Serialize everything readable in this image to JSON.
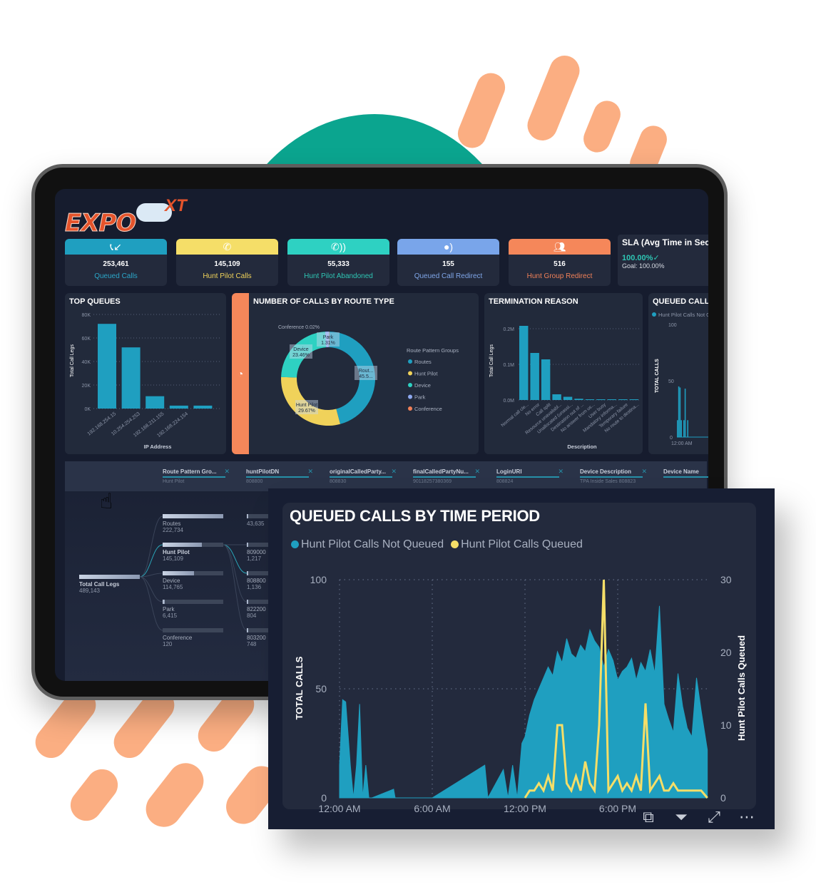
{
  "brand": {
    "logo_text": "EXPO",
    "logo_sup": "XT"
  },
  "kpis": [
    {
      "value": "253,461",
      "label": "Queued Calls",
      "icon": "phone-incoming-icon",
      "color": "#1f9fc0",
      "label_color": "#2ba7c9"
    },
    {
      "value": "145,109",
      "label": "Hunt Pilot Calls",
      "icon": "phone-icon",
      "color": "#f5de68",
      "label_color": "#f0d25a"
    },
    {
      "value": "55,333",
      "label": "Hunt Pilot Abandoned",
      "icon": "phone-ringing-icon",
      "color": "#2ed1c2",
      "label_color": "#2ec6b4"
    },
    {
      "value": "155",
      "label": "Queued Call Redirect",
      "icon": "user-voice-icon",
      "color": "#79a5ea",
      "label_color": "#7fa6e8"
    },
    {
      "value": "516",
      "label": "Hunt Group Redirect",
      "icon": "users-icon",
      "color": "#f5875a",
      "label_color": "#f08058"
    }
  ],
  "sla": {
    "title": "SLA (Avg Time in Secs",
    "value": "100.00%",
    "check": "✓",
    "goal": "Goal: 100.00%"
  },
  "top_queues": {
    "title": "TOP QUEUES",
    "chart_data": {
      "type": "bar",
      "title": "TOP QUEUES",
      "xlabel": "IP Address",
      "ylabel": "Total Call Legs",
      "ylim": [
        0,
        80000
      ],
      "yticks": [
        "0K",
        "20K",
        "40K",
        "60K",
        "80K"
      ],
      "categories": [
        "192.168.254.15",
        "10.254.254.253",
        "192.168.211.155",
        "192.168.224.154"
      ],
      "values": [
        72000,
        52000,
        10500,
        2500,
        2500
      ],
      "extra_category_count_note": ""
    }
  },
  "route_type": {
    "title": "NUMBER OF CALLS BY ROUTE TYPE",
    "strip_icon": "pie-chart-icon",
    "chart_data": {
      "type": "pie",
      "title": "NUMBER OF CALLS BY ROUTE TYPE",
      "legend_title": "Route Pattern Groups",
      "legend_position": "right",
      "slices": [
        {
          "name": "Routes",
          "value": 45.54,
          "label": "Rout... 45.5...",
          "color": "#1f9fc0"
        },
        {
          "name": "Hunt Pilot",
          "value": 29.67,
          "label": "Hunt Pilot 29.67%",
          "color": "#f0d25a"
        },
        {
          "name": "Device",
          "value": 23.46,
          "label": "Device 23.46%",
          "color": "#2ed1c2"
        },
        {
          "name": "Park",
          "value": 1.31,
          "label": "Park 1.31%",
          "color": "#8ea9f0"
        },
        {
          "name": "Conference",
          "value": 0.02,
          "label": "Conference 0.02%",
          "color": "#f08058"
        }
      ]
    }
  },
  "termination": {
    "title": "TERMINATION REASON",
    "chart_data": {
      "type": "bar",
      "title": "TERMINATION REASON",
      "xlabel": "Description",
      "ylabel": "Total Call Legs",
      "ylim": [
        0,
        200000
      ],
      "yticks": [
        "0.0M",
        "0.1M",
        "0.2M"
      ],
      "categories": [
        "Normal call cle...",
        "No error",
        "Call split",
        "Resource unavailabl...",
        "Unallocated (unassi...",
        "Destination out of ...",
        "No answer from us...",
        "User busy",
        "Mandatory informa...",
        "Temporary failure",
        "No route to destina..."
      ],
      "values": [
        208000,
        132000,
        114000,
        16000,
        9000,
        3500,
        1000,
        800,
        600,
        500,
        400
      ]
    }
  },
  "queued_small": {
    "title": "QUEUED CALLS BY TIME PERIOD",
    "legend": "Hunt Pilot Calls Not Queued",
    "ylabel": "TOTAL CALLS",
    "yticks": [
      "0",
      "50",
      "100"
    ],
    "xtick": "12:00 AM"
  },
  "filters": [
    {
      "header": "Route Pattern Gro...",
      "value": "Hunt Pilot"
    },
    {
      "header": "huntPilotDN",
      "value": "808800"
    },
    {
      "header": "originalCalledParty...",
      "value": "808830"
    },
    {
      "header": "finalCalledPartyNu...",
      "value": "90118257380369"
    },
    {
      "header": "LoginURI",
      "value": "808824"
    },
    {
      "header": "Device Description",
      "value": "TPA Inside Sales 808823"
    },
    {
      "header": "Device Name",
      "value": ""
    }
  ],
  "decomposition": {
    "root": {
      "name": "Total Call Legs",
      "value": "489,143"
    },
    "level1": [
      {
        "name": "Routes",
        "value": "222,734",
        "fill": 1.0
      },
      {
        "name": "Hunt Pilot",
        "value": "145,109",
        "fill": 0.65
      },
      {
        "name": "Device",
        "value": "114,765",
        "fill": 0.52
      },
      {
        "name": "Park",
        "value": "6,415",
        "fill": 0.03
      },
      {
        "name": "Conference",
        "value": "120",
        "fill": 0.0
      }
    ],
    "level2": [
      {
        "name": "",
        "value": "43,635"
      },
      {
        "name": "809000",
        "value": "1,217"
      },
      {
        "name": "808800",
        "value": "1,136"
      },
      {
        "name": "822200",
        "value": "804"
      },
      {
        "name": "803200",
        "value": "748"
      }
    ]
  },
  "main_chart": {
    "title": "QUEUED CALLS BY TIME PERIOD",
    "legend": [
      {
        "name": "Hunt Pilot Calls Not Queued",
        "color": "#1f9fc0"
      },
      {
        "name": "Hunt Pilot Calls Queued",
        "color": "#f5de68"
      }
    ],
    "toolbar": [
      {
        "name": "copy-icon",
        "glyph": "⧉"
      },
      {
        "name": "filter-icon",
        "glyph": "⏷"
      },
      {
        "name": "expand-icon",
        "glyph": "⤢"
      },
      {
        "name": "more-icon",
        "glyph": "⋯"
      }
    ]
  },
  "chart_data": {
    "type": "area",
    "title": "QUEUED CALLS BY TIME PERIOD",
    "xlabel": "",
    "ylabel": "TOTAL CALLS",
    "y2label": "Hunt Pilot Calls Queued",
    "ylim": [
      0,
      100
    ],
    "y2lim": [
      0,
      30
    ],
    "yticks": [
      0,
      50,
      100
    ],
    "y2ticks": [
      0,
      10,
      20,
      30
    ],
    "xticks": [
      "12:00 AM",
      "6:00 AM",
      "12:00 PM",
      "6:00 PM"
    ],
    "x_hours": [
      0,
      0.2,
      0.4,
      0.7,
      0.9,
      1.1,
      1.3,
      1.5,
      1.7,
      1.9,
      2.1,
      3.5,
      3.6,
      6,
      9.4,
      9.6,
      10.6,
      10.9,
      11.2,
      11.5,
      11.8,
      12.0,
      12.3,
      12.6,
      12.9,
      13.2,
      13.5,
      13.8,
      14.1,
      14.4,
      14.7,
      15.0,
      15.3,
      15.6,
      15.9,
      16.2,
      16.5,
      16.8,
      17.1,
      17.4,
      17.7,
      18.0,
      18.3,
      18.6,
      18.9,
      19.2,
      19.5,
      19.8,
      20.1,
      20.4,
      20.7,
      21.0,
      21.3,
      21.6,
      21.9,
      22.2,
      22.5,
      22.8,
      23.1,
      23.4,
      23.8
    ],
    "series": [
      {
        "name": "Hunt Pilot Calls Not Queued",
        "axis": "left",
        "values": [
          15,
          45,
          44,
          15,
          0,
          15,
          43,
          0,
          15,
          0,
          0,
          4,
          0,
          0,
          15,
          0,
          13,
          0,
          15,
          0,
          25,
          28,
          38,
          45,
          50,
          55,
          60,
          56,
          67,
          62,
          73,
          66,
          64,
          70,
          67,
          77,
          72,
          69,
          60,
          68,
          63,
          54,
          58,
          60,
          64,
          54,
          62,
          58,
          68,
          57,
          88,
          43,
          36,
          30,
          57,
          42,
          32,
          28,
          55,
          40,
          22
        ]
      },
      {
        "name": "Hunt Pilot Calls Queued",
        "axis": "right",
        "values": [
          0,
          0,
          0,
          0,
          0,
          0,
          0,
          0,
          0,
          0,
          0,
          0,
          0,
          0,
          0,
          0,
          0,
          0,
          0,
          0,
          0,
          0,
          1,
          1,
          2,
          1,
          3,
          1,
          10,
          10,
          2,
          1,
          3,
          1,
          5,
          2,
          1,
          10,
          30,
          1,
          2,
          3,
          1,
          2,
          1,
          3,
          1,
          13,
          1,
          2,
          3,
          1,
          1,
          2,
          1,
          1,
          1,
          1,
          1,
          1,
          0
        ]
      }
    ]
  }
}
